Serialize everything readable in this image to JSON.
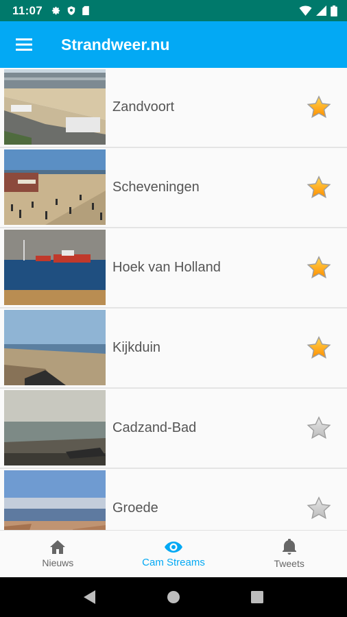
{
  "status_bar": {
    "time": "11:07",
    "left_icons": [
      "settings-icon",
      "shield-icon",
      "sd-card-icon"
    ],
    "right_icons": [
      "wifi-icon",
      "signal-icon",
      "battery-icon"
    ]
  },
  "app_bar": {
    "title": "Strandweer.nu",
    "menu_icon": "hamburger-menu-icon",
    "color": "#03a9f4"
  },
  "cams": [
    {
      "name": "Zandvoort",
      "favorite": true
    },
    {
      "name": "Scheveningen",
      "favorite": true
    },
    {
      "name": "Hoek van Holland",
      "favorite": true
    },
    {
      "name": "Kijkduin",
      "favorite": true
    },
    {
      "name": "Cadzand-Bad",
      "favorite": false
    },
    {
      "name": "Groede",
      "favorite": false
    }
  ],
  "bottom_nav": {
    "items": [
      {
        "label": "Nieuws",
        "icon": "home-icon",
        "active": false
      },
      {
        "label": "Cam Streams",
        "icon": "eye-icon",
        "active": true
      },
      {
        "label": "Tweets",
        "icon": "bell-icon",
        "active": false
      }
    ],
    "active_color": "#03a9f4"
  },
  "system_nav": [
    "back-icon",
    "home-circle-icon",
    "recents-icon"
  ]
}
